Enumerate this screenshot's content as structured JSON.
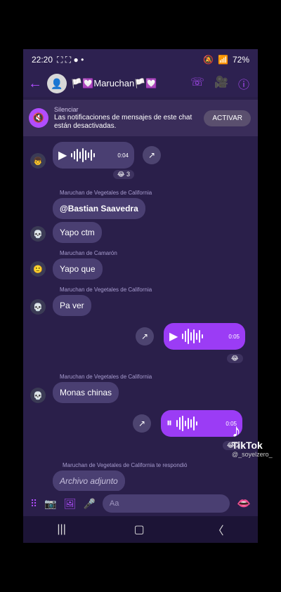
{
  "status": {
    "time": "22:20",
    "battery": "72%"
  },
  "header": {
    "title": "🏳️💟Maruchan🏳️💟"
  },
  "notice": {
    "small": "Silenciar",
    "text": "Las notificaciones de mensajes de este chat están desactivadas.",
    "button": "ACTIVAR"
  },
  "chat": {
    "msgs": [
      {
        "type": "audio-in",
        "duration": "0:04",
        "reaction": "😂 3"
      },
      {
        "sender": "Maruchan de Vegetales de California",
        "text": "@Bastian Saavedra"
      },
      {
        "text": "Yapo ctm"
      },
      {
        "sender": "Maruchan de Camarón",
        "text": "Yapo que"
      },
      {
        "sender": "Maruchan de Vegetales de California",
        "text": "Pa ver"
      },
      {
        "type": "audio-out",
        "duration": "0:05",
        "reaction": "😂"
      },
      {
        "sender": "Maruchan de Vegetales de California",
        "text": "Monas chinas"
      },
      {
        "type": "audio-out2",
        "duration": "0:05",
        "reaction": "😂 2"
      },
      {
        "reply": "Maruchan de Vegetales de California te respondió",
        "text": "Archivo adjunto"
      }
    ]
  },
  "footer": {
    "placeholder": "Aa"
  },
  "watermark": {
    "brand": "TikTok",
    "user": "@_soyelzero_"
  }
}
